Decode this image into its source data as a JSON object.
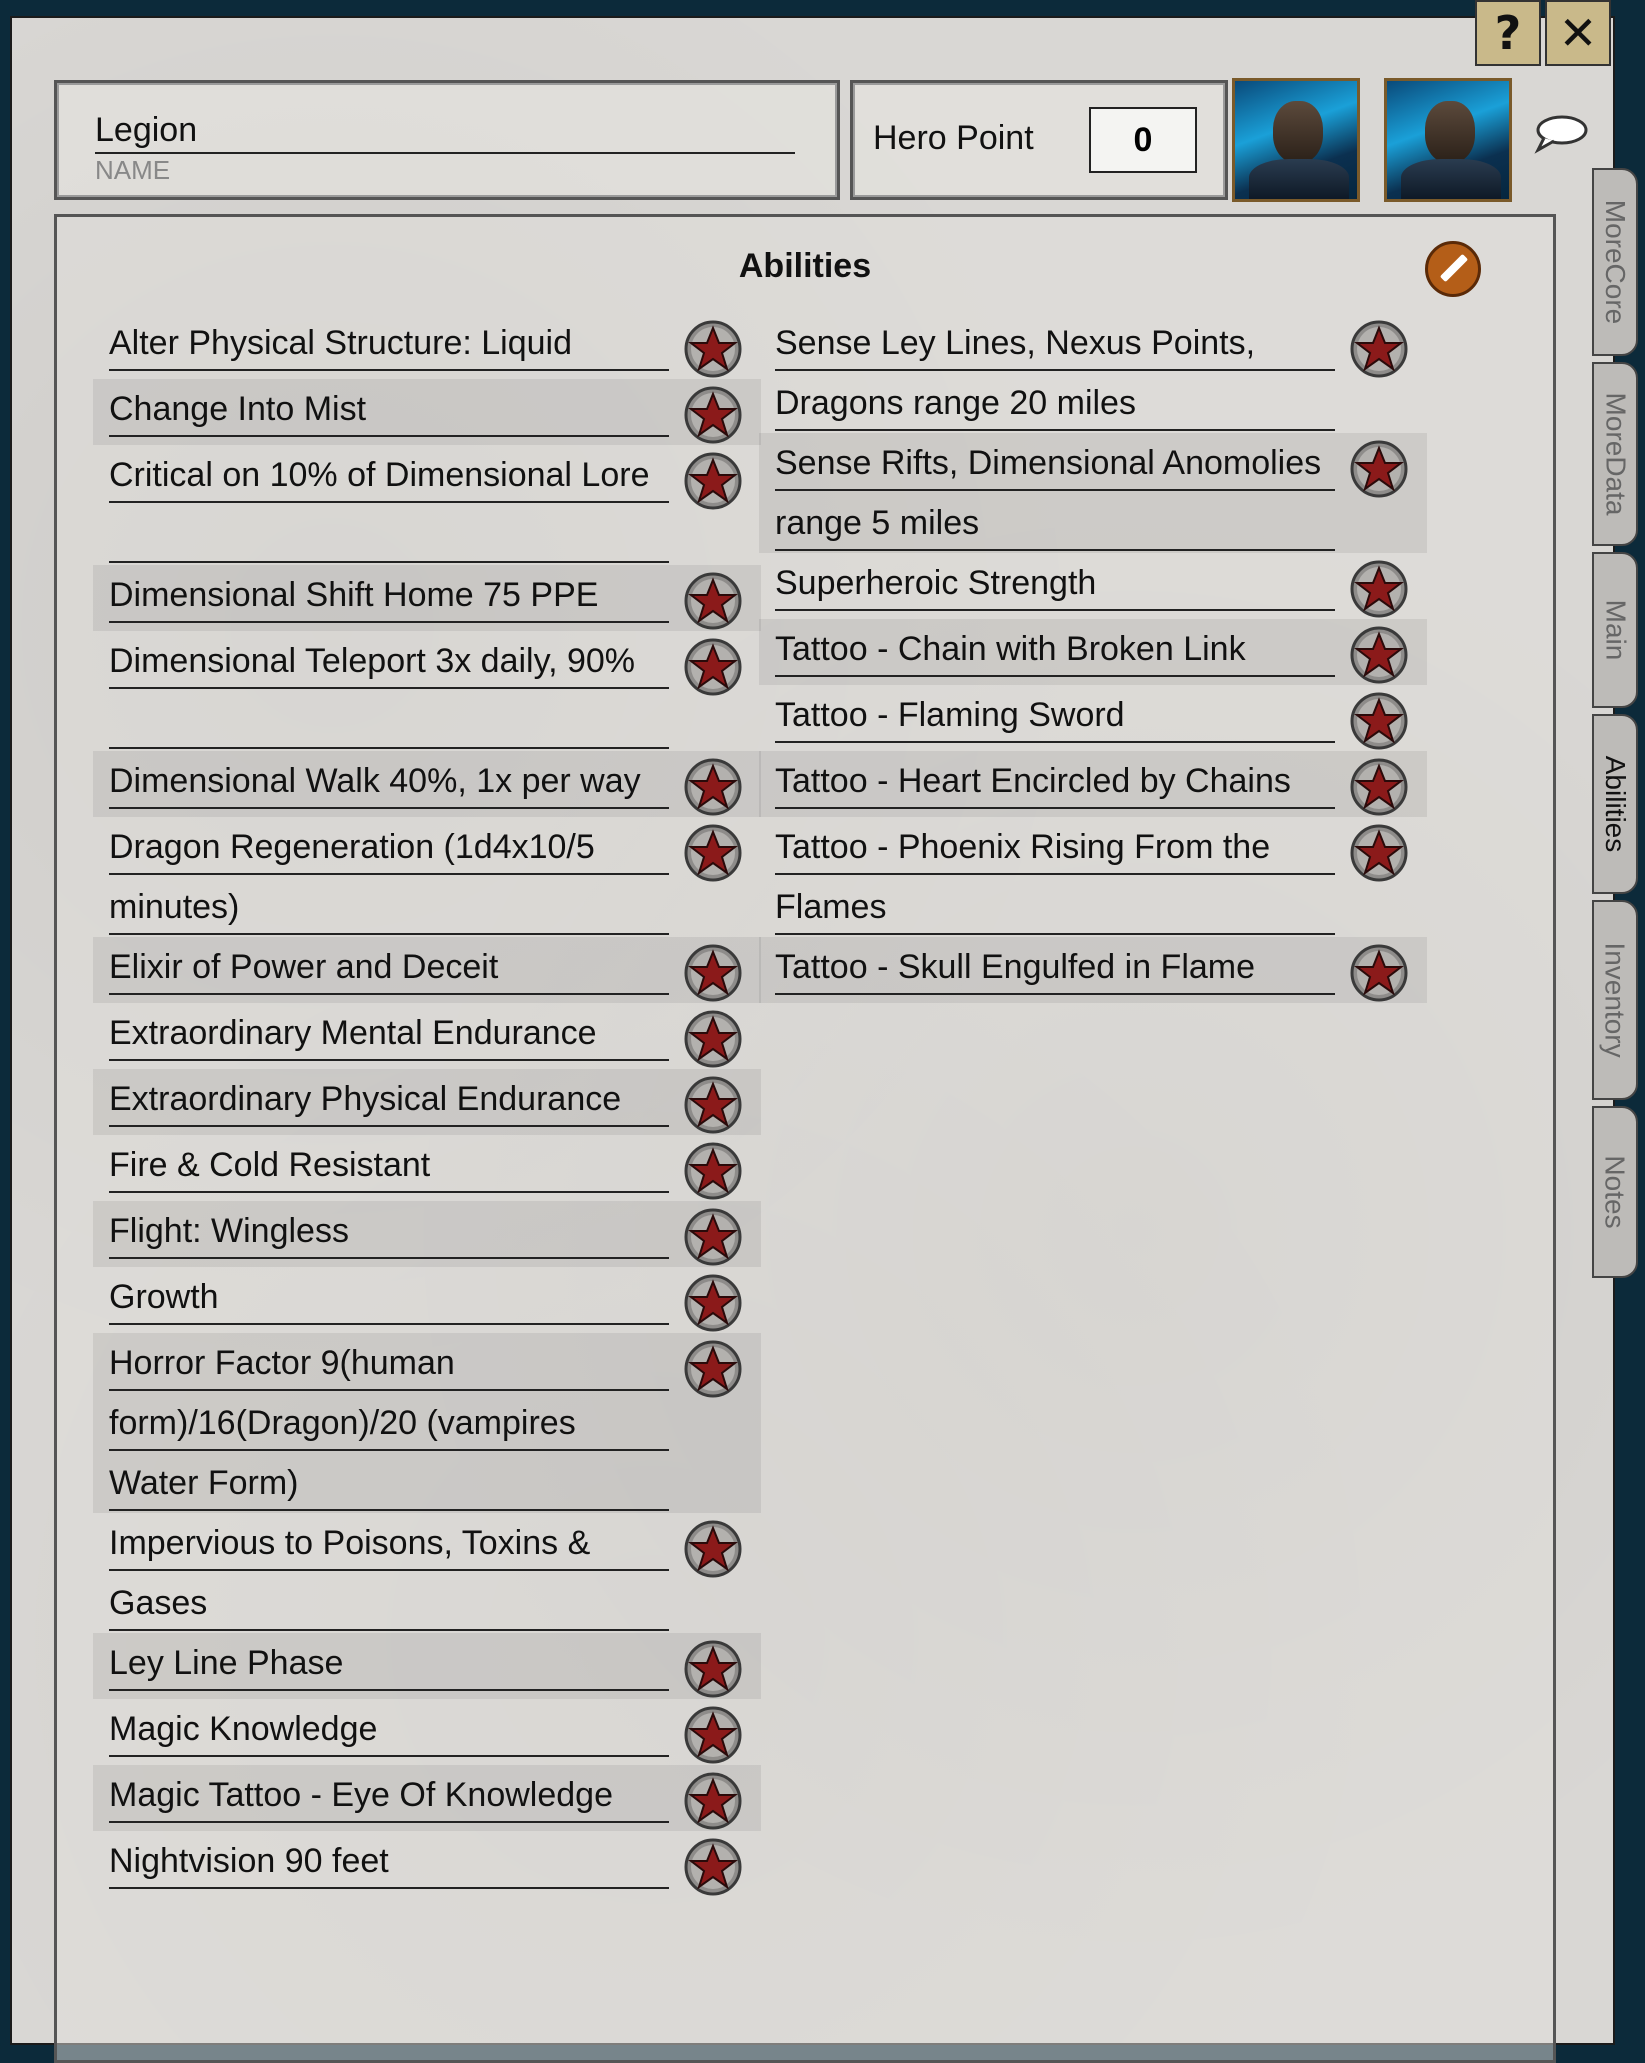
{
  "window": {
    "help_label": "?",
    "close_label": "✕"
  },
  "header": {
    "name_value": "Legion",
    "name_label": "NAME",
    "hero_point_label": "Hero Point",
    "hero_point_value": "0"
  },
  "section": {
    "title": "Abilities"
  },
  "abilities_left": [
    "Alter Physical Structure: Liquid",
    "Change Into Mist",
    "Critical on 10% of Dimensional Lore",
    "Dimensional Shift Home 75 PPE",
    "Dimensional Teleport 3x daily, 90%",
    "Dimensional Walk 40%, 1x per way",
    "Dragon Regeneration (1d4x10/5 minutes)",
    "Elixir of Power and Deceit",
    "Extraordinary Mental Endurance",
    "Extraordinary Physical Endurance",
    "Fire & Cold Resistant",
    "Flight: Wingless",
    "Growth",
    "Horror Factor 9(human form)/16(Dragon)/20 (vampires Water Form)",
    "Impervious to Poisons, Toxins & Gases",
    "Ley Line Phase",
    "Magic Knowledge",
    "Magic Tattoo - Eye Of Knowledge",
    "Nightvision 90 feet"
  ],
  "abilities_right": [
    "Sense Ley Lines, Nexus Points, Dragons range 20 miles",
    "Sense Rifts, Dimensional Anomolies range 5 miles",
    "Superheroic Strength",
    "Tattoo - Chain with Broken Link",
    "Tattoo - Flaming Sword",
    "Tattoo - Heart Encircled by Chains",
    "Tattoo - Phoenix Rising From the Flames",
    "Tattoo - Skull Engulfed in Flame"
  ],
  "tabs": [
    "MoreCore",
    "MoreData",
    "Main",
    "Abilities",
    "Inventory",
    "Notes"
  ],
  "active_tab": "Abilities",
  "colors": {
    "star_fill": "#8b1a1a",
    "edit_button": "#b45e18",
    "frame_gold": "#c9b98a"
  },
  "icons": {
    "roll": "star-icon",
    "edit": "pencil-icon",
    "chat": "speech-bubble-icon"
  }
}
